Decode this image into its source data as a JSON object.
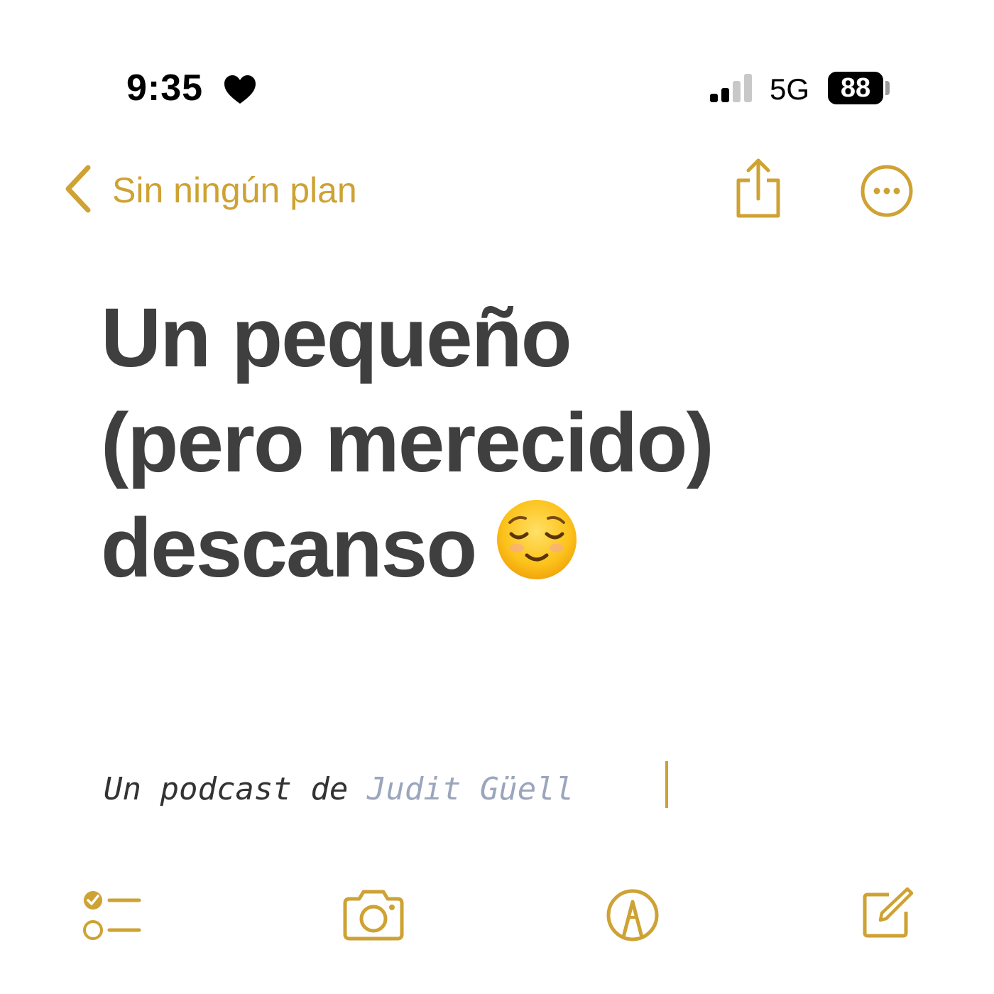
{
  "status_bar": {
    "time": "9:35",
    "network": "5G",
    "battery": "88",
    "icons": [
      "heart-icon",
      "signal-icon"
    ]
  },
  "nav": {
    "back_label": "Sin ningún plan",
    "icons": [
      "chevron-left-icon",
      "share-icon",
      "more-icon"
    ]
  },
  "note": {
    "title_lines": [
      "Un pequeño",
      "(pero merecido)",
      "descanso"
    ],
    "title_emoji": "relieved-face-emoji",
    "byline_prefix": "Un podcast de ",
    "byline_author": "Judit Güell"
  },
  "toolbar": {
    "icons": [
      "checklist-icon",
      "camera-icon",
      "markup-icon",
      "compose-icon"
    ]
  },
  "colors": {
    "accent": "#cea233",
    "title": "#3f3f3f",
    "author": "#9ba6bd",
    "background": "#ffffff"
  }
}
